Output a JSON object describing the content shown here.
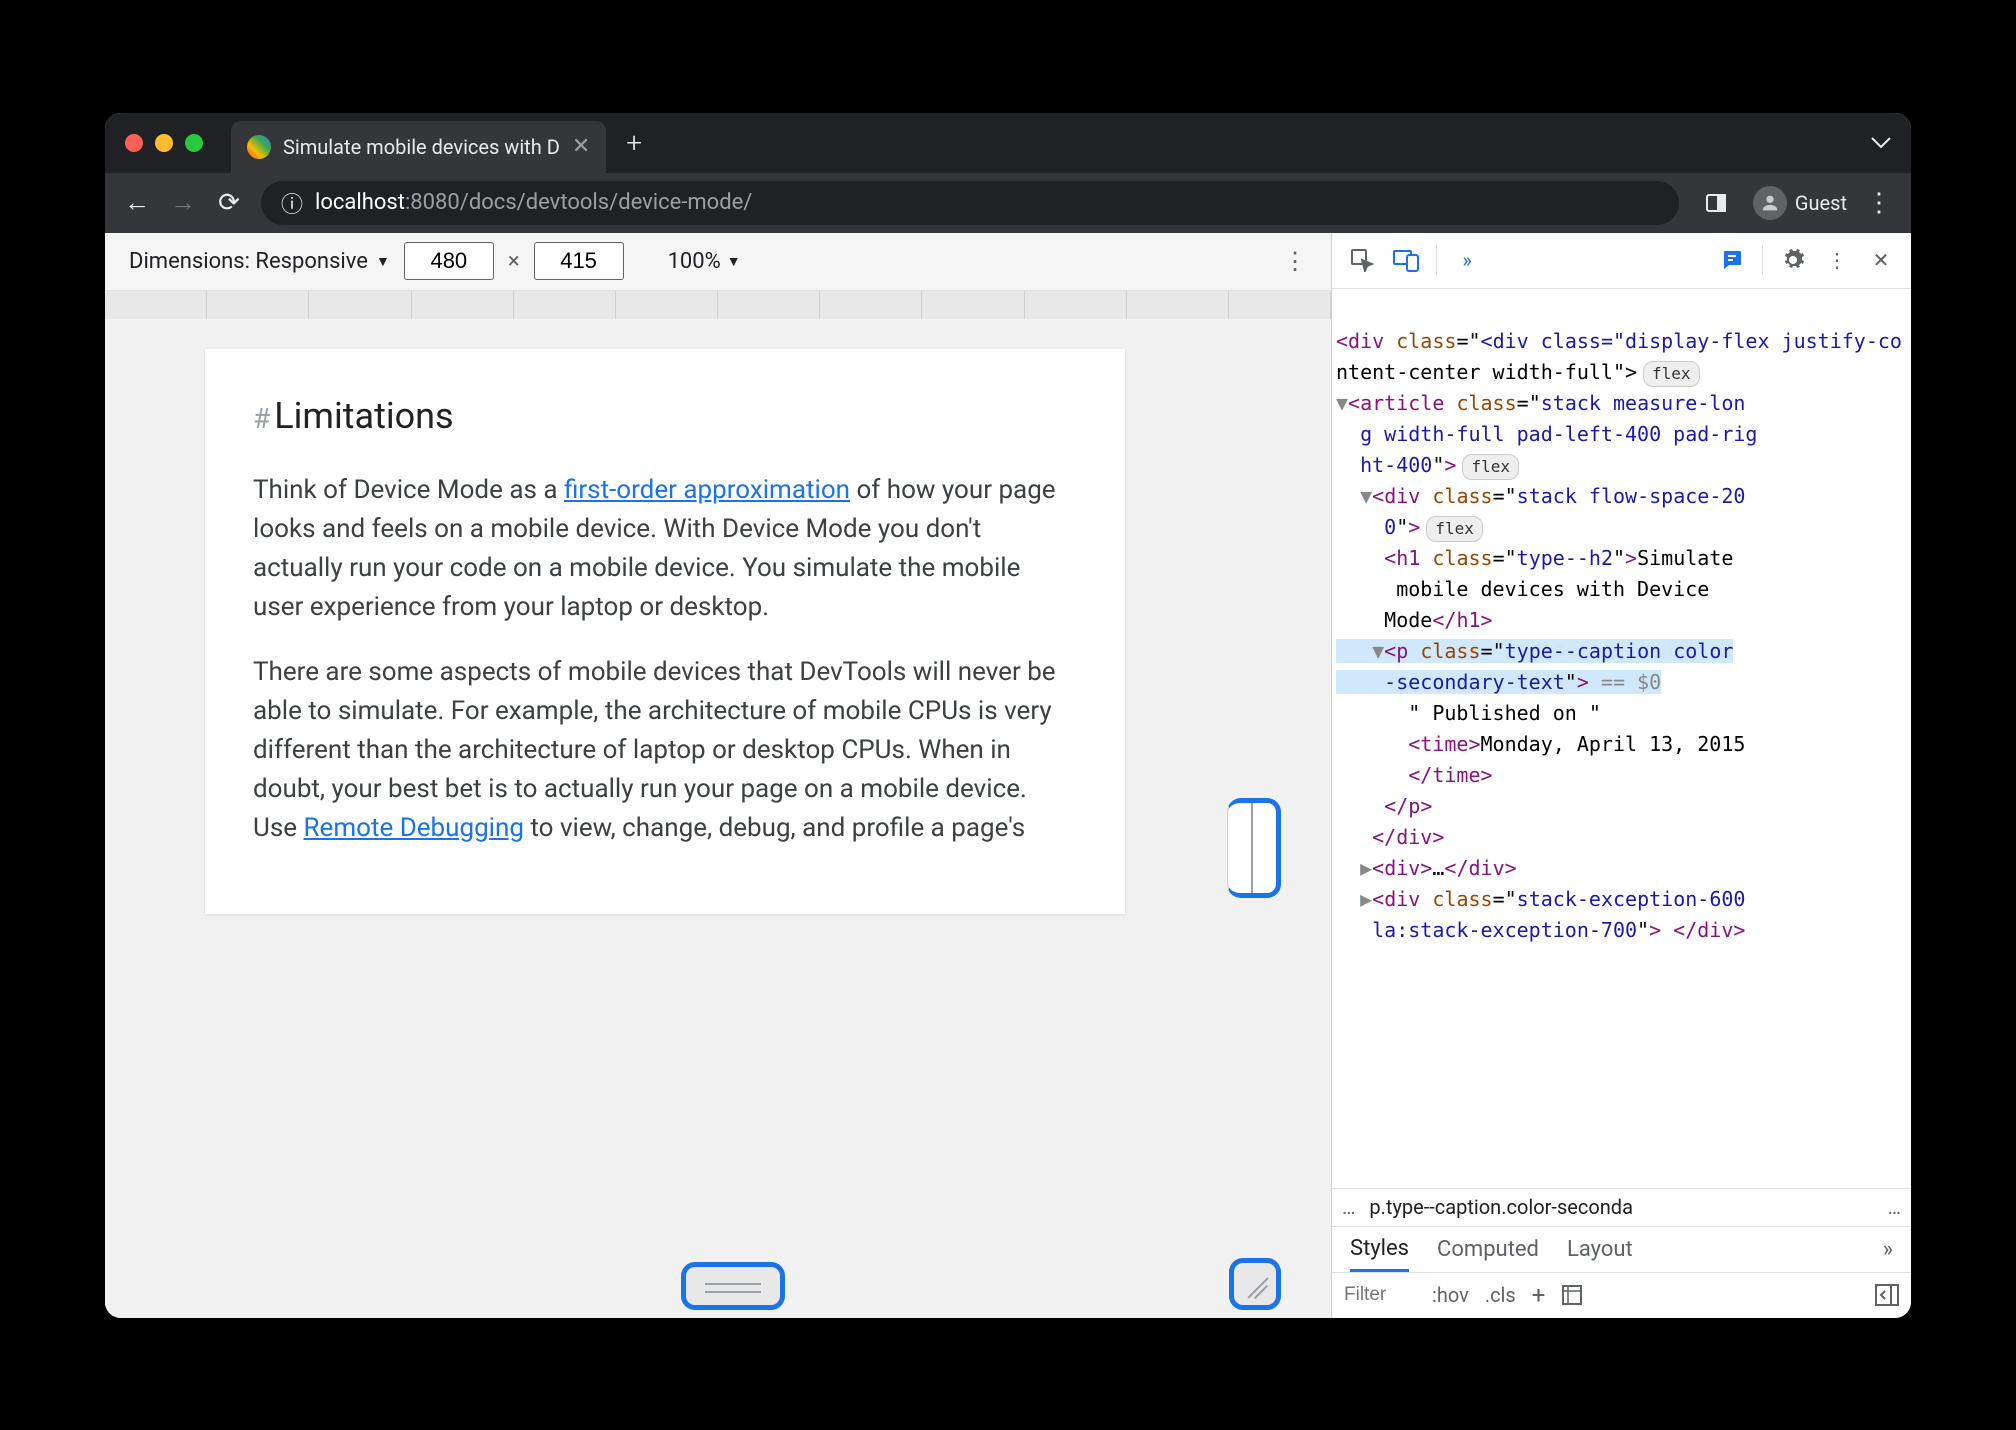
{
  "tab": {
    "title": "Simulate mobile devices with D"
  },
  "url": {
    "info_icon": "ⓘ",
    "host": "localhost",
    "port": ":8080",
    "path": "/docs/devtools/device-mode/"
  },
  "profile": {
    "label": "Guest"
  },
  "devicebar": {
    "label": "Dimensions: Responsive",
    "width": "480",
    "height": "415",
    "zoom": "100%"
  },
  "page": {
    "heading": "Limitations",
    "p1a": "Think of Device Mode as a ",
    "p1link": "first-order approximation",
    "p1b": " of how your page looks and feels on a mobile device. With Device Mode you don't actually run your code on a mobile device. You simulate the mobile user experience from your laptop or desktop.",
    "p2a": "There are some aspects of mobile devices that DevTools will never be able to simulate. For example, the architecture of mobile CPUs is very different than the architecture of laptop or desktop CPUs. When in doubt, your best bet is to actually run your page on a mobile device. Use ",
    "p2link": "Remote Debugging",
    "p2b": " to view, change, debug, and profile a page's"
  },
  "elements": {
    "l1": "<div class=\"display-flex justify-co",
    "l2": "ntent-center width-full\">",
    "pill1": "flex",
    "l3a": "<article class=\"stack measure-lon",
    "l3b": "g width-full pad-left-400 pad-rig",
    "l3c": "ht-400\">",
    "pill2": "flex",
    "l4a": "<div class=\"stack flow-space-20",
    "l4b": "0\">",
    "pill3": "flex",
    "l5a": "<h1 class=\"type--h2\">Simulate",
    "l5b": " mobile devices with Device ",
    "l5c": "Mode</h1>",
    "sel_a": "<p class=\"type--caption color",
    "sel_b": "-secondary-text\">",
    "sel_c": " == $0",
    "pub": "\" Published on \"",
    "time_a": "<time>Monday, April 13, 2015",
    "time_b": "</time>",
    "close_p": "</p>",
    "close_div": "</div>",
    "more_div": "<div>…</div>",
    "stack_ex": "<div class=\"stack-exception-600",
    "stack_ex2": " la:stack-exception-700\"> </div>"
  },
  "crumbs": {
    "dots": "…",
    "path": "p.type--caption.color-seconda",
    "more": "…"
  },
  "styles": {
    "tabs": [
      "Styles",
      "Computed",
      "Layout"
    ],
    "more": "»",
    "filter_placeholder": "Filter",
    "hov": ":hov",
    "cls": ".cls"
  }
}
